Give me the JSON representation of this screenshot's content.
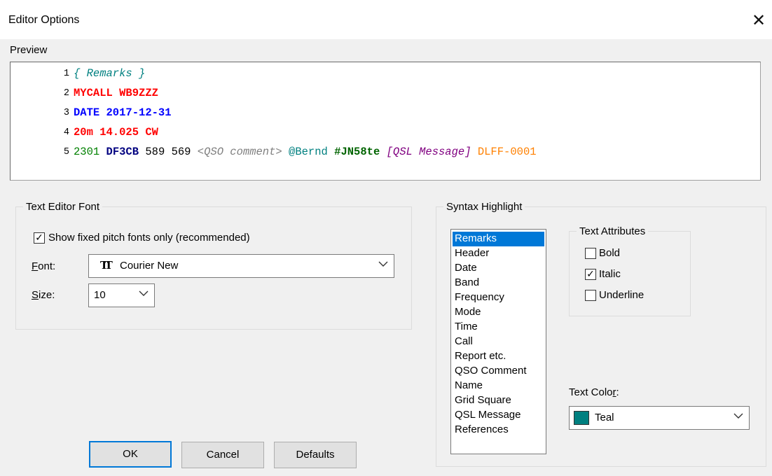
{
  "window": {
    "title": "Editor Options",
    "close_glyph": "✕"
  },
  "preview": {
    "label": "Preview",
    "lines": [
      {
        "num": "1"
      },
      {
        "num": "2"
      },
      {
        "num": "3"
      },
      {
        "num": "4"
      },
      {
        "num": "5"
      }
    ],
    "tokens": {
      "remarks": "{ Remarks }",
      "mycall": "MYCALL WB9ZZZ",
      "date": "DATE 2017-12-31",
      "band_line": "20m 14.025 CW",
      "time": "2301",
      "call": "DF3CB",
      "report": "589 569",
      "qso_comment": "<QSO comment>",
      "name": "@Bernd",
      "grid": "#JN58te",
      "qsl": "[QSL Message]",
      "refs": "DLFF-0001"
    },
    "colors": {
      "remarks": "#008080",
      "header": "#ff0000",
      "date": "#0000ff",
      "band": "#ff0000",
      "time": "#008000",
      "call": "#000080",
      "report": "#000000",
      "qso_comment": "#808080",
      "name": "#008080",
      "grid": "#006400",
      "qsl": "#800080",
      "refs": "#ff8000"
    }
  },
  "text_editor_font": {
    "legend": "Text Editor Font",
    "fixed_pitch_label": "Show fixed pitch fonts only (recommended)",
    "fixed_pitch_checked": true,
    "font_label_prefix": "F",
    "font_label_rest": "ont:",
    "font_value": "Courier New",
    "size_label_prefix": "S",
    "size_label_rest": "ize:",
    "size_value": "10"
  },
  "syntax_highlight": {
    "legend": "Syntax Highlight",
    "items": [
      "Remarks",
      "Header",
      "Date",
      "Band",
      "Frequency",
      "Mode",
      "Time",
      "Call",
      "Report etc.",
      "QSO Comment",
      "Name",
      "Grid Square",
      "QSL Message",
      "References"
    ],
    "selected": "Remarks",
    "text_attributes": {
      "legend": "Text Attributes",
      "bold": {
        "label": "Bold",
        "checked": false
      },
      "italic": {
        "label": "Italic",
        "checked": true
      },
      "underline": {
        "label": "Underline",
        "checked": false
      }
    },
    "text_color_label_prefix": "Text Colo",
    "text_color_label_u": "r",
    "text_color_label_suffix": ":",
    "text_color_value": "Teal",
    "text_color_swatch": "#008080"
  },
  "buttons": {
    "ok": "OK",
    "cancel": "Cancel",
    "defaults": "Defaults"
  }
}
